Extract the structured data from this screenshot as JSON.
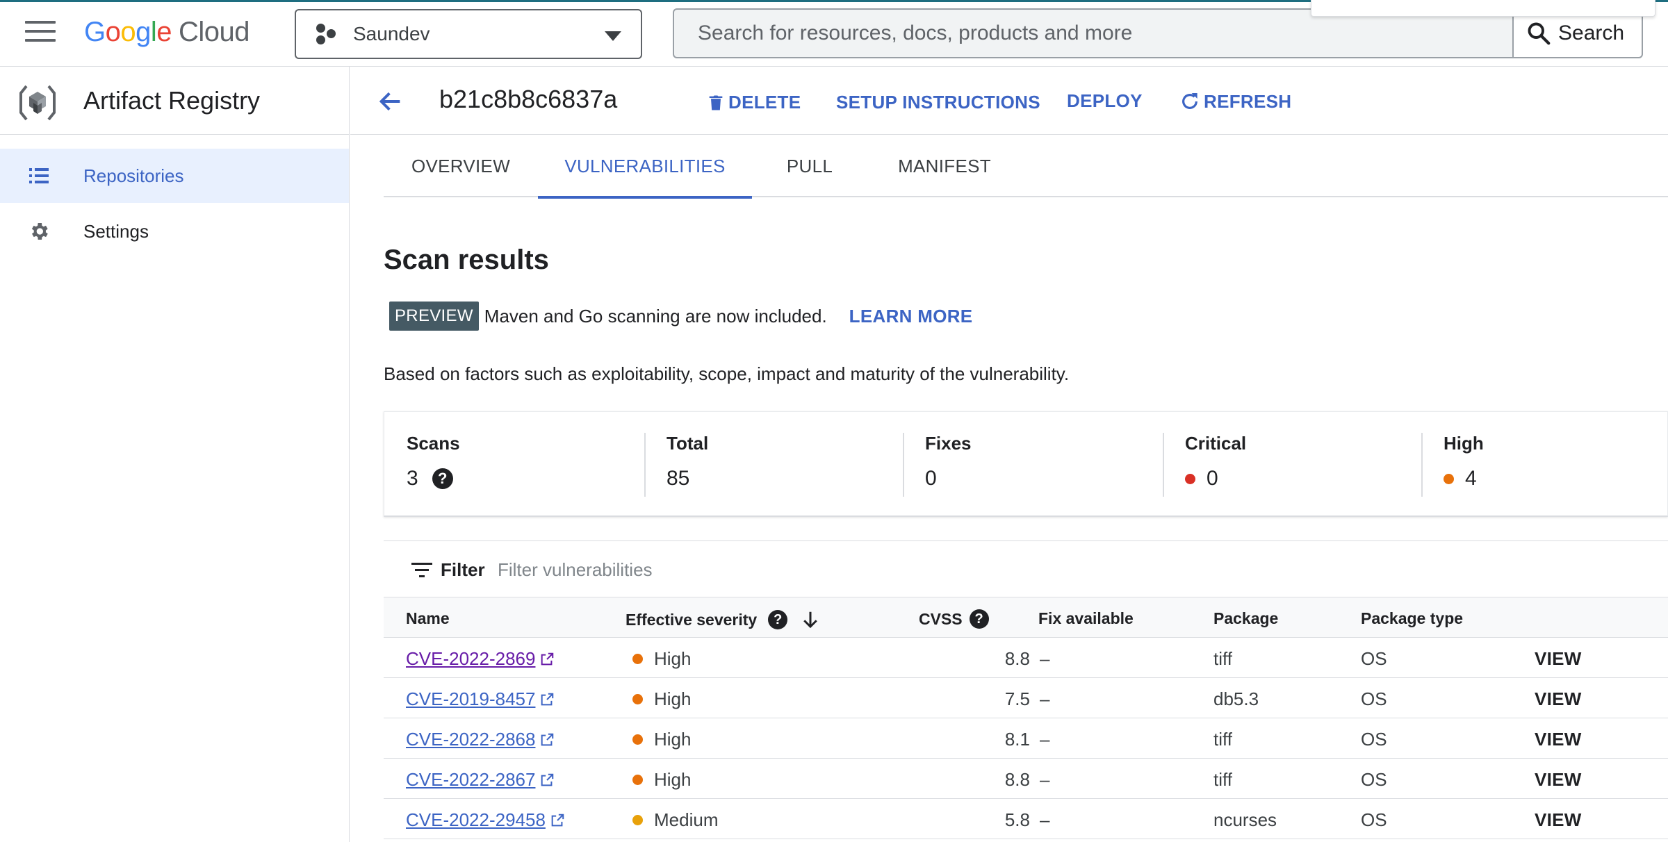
{
  "header": {
    "logo_google": [
      "G",
      "o",
      "o",
      "g",
      "l",
      "e"
    ],
    "logo_cloud": "Cloud",
    "project_name": "Saundev",
    "search_placeholder": "Search for resources, docs, products and more",
    "search_button": "Search"
  },
  "sidebar": {
    "title": "Artifact Registry",
    "items": [
      {
        "label": "Repositories",
        "icon": "list-icon",
        "active": true
      },
      {
        "label": "Settings",
        "icon": "gear-icon",
        "active": false
      }
    ]
  },
  "page": {
    "image_title": "b21c8b8c6837a",
    "actions": {
      "delete": "DELETE",
      "setup": "SETUP INSTRUCTIONS",
      "deploy": "DEPLOY",
      "refresh": "REFRESH"
    },
    "tabs": [
      {
        "label": "OVERVIEW",
        "active": false
      },
      {
        "label": "VULNERABILITIES",
        "active": true
      },
      {
        "label": "PULL",
        "active": false
      },
      {
        "label": "MANIFEST",
        "active": false
      }
    ],
    "scan_title": "Scan results",
    "preview_badge": "PREVIEW",
    "preview_text": "Maven and Go scanning are now included.",
    "learn_more": "LEARN MORE",
    "based_text": "Based on factors such as exploitability, scope, impact and maturity of the vulnerability."
  },
  "stats": [
    {
      "label": "Scans",
      "value": "3"
    },
    {
      "label": "Total",
      "value": "85"
    },
    {
      "label": "Fixes",
      "value": "0"
    },
    {
      "label": "Critical",
      "value": "0"
    },
    {
      "label": "High",
      "value": "4"
    }
  ],
  "filter": {
    "label": "Filter",
    "placeholder": "Filter vulnerabilities"
  },
  "table": {
    "headers": {
      "name": "Name",
      "severity": "Effective severity",
      "cvss": "CVSS",
      "fix": "Fix available",
      "package": "Package",
      "package_type": "Package type"
    },
    "rows": [
      {
        "name": "CVE-2022-2869",
        "severity": "High",
        "cvss": "8.8",
        "fix": "–",
        "package": "tiff",
        "type": "OS",
        "action": "VIEW"
      },
      {
        "name": "CVE-2019-8457",
        "severity": "High",
        "cvss": "7.5",
        "fix": "–",
        "package": "db5.3",
        "type": "OS",
        "action": "VIEW"
      },
      {
        "name": "CVE-2022-2868",
        "severity": "High",
        "cvss": "8.1",
        "fix": "–",
        "package": "tiff",
        "type": "OS",
        "action": "VIEW"
      },
      {
        "name": "CVE-2022-2867",
        "severity": "High",
        "cvss": "8.8",
        "fix": "–",
        "package": "tiff",
        "type": "OS",
        "action": "VIEW"
      },
      {
        "name": "CVE-2022-29458",
        "severity": "Medium",
        "cvss": "5.8",
        "fix": "–",
        "package": "ncurses",
        "type": "OS",
        "action": "VIEW"
      }
    ]
  },
  "colors": {
    "accent": "#3c64c4",
    "critical": "#d93025",
    "high": "#e8710a",
    "medium": "#e8a10a",
    "visited_link": "#681da8"
  }
}
